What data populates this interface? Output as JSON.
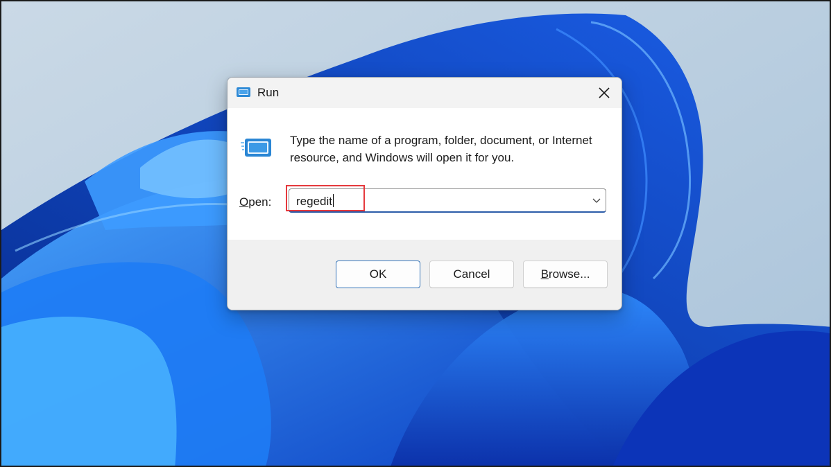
{
  "dialog": {
    "title": "Run",
    "description": "Type the name of a program, folder, document, or Internet resource, and Windows will open it for you.",
    "open_label_prefix": "O",
    "open_label_rest": "pen:",
    "input_value": "regedit",
    "buttons": {
      "ok": "OK",
      "cancel": "Cancel",
      "browse_prefix": "B",
      "browse_rest": "rowse..."
    }
  },
  "icons": {
    "title": "run-icon",
    "content": "run-icon",
    "close": "close-icon",
    "dropdown": "chevron-down-icon"
  },
  "colors": {
    "highlight": "#e5393d",
    "accent": "#2b5ba8",
    "wallpaper_blue": "#1a6ff0"
  }
}
